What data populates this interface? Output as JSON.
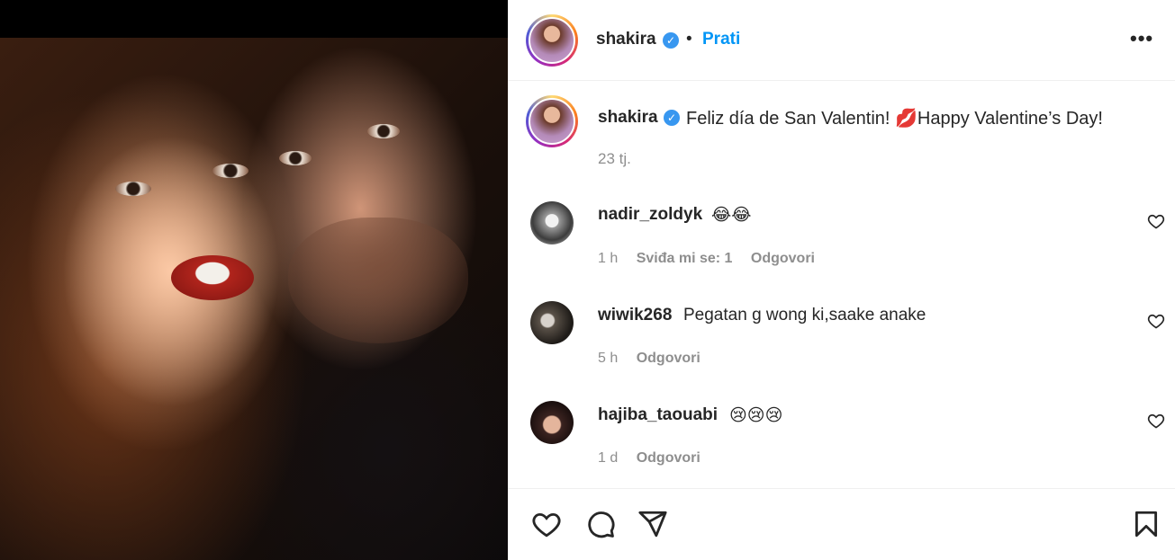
{
  "post": {
    "author": "shakira",
    "verified_icon": "verified-badge-icon",
    "separator": "•",
    "follow_label": "Prati",
    "more_label": "•••"
  },
  "caption": {
    "username": "shakira",
    "text": "Feliz día de San Valentin! 💋Happy Valentine’s Day!",
    "time": "23 tj."
  },
  "comments": [
    {
      "username": "nadir_zoldyk",
      "text": "😂😂",
      "time": "1 h",
      "likes": "Sviđa mi se: 1",
      "reply": "Odgovori"
    },
    {
      "username": "wiwik268",
      "text": "Pegatan g wong ki,saake anake",
      "time": "5 h",
      "reply": "Odgovori"
    },
    {
      "username": "hajiba_taouabi",
      "text": "😢😢😢",
      "time": "1 d",
      "reply": "Odgovori"
    }
  ],
  "actions": {
    "like_icon": "heart-icon",
    "comment_icon": "comment-bubble-icon",
    "share_icon": "paper-plane-icon",
    "save_icon": "bookmark-icon"
  },
  "colors": {
    "accent": "#0095f6",
    "muted_text": "#8e8e8e",
    "verified": "#3897f0"
  }
}
